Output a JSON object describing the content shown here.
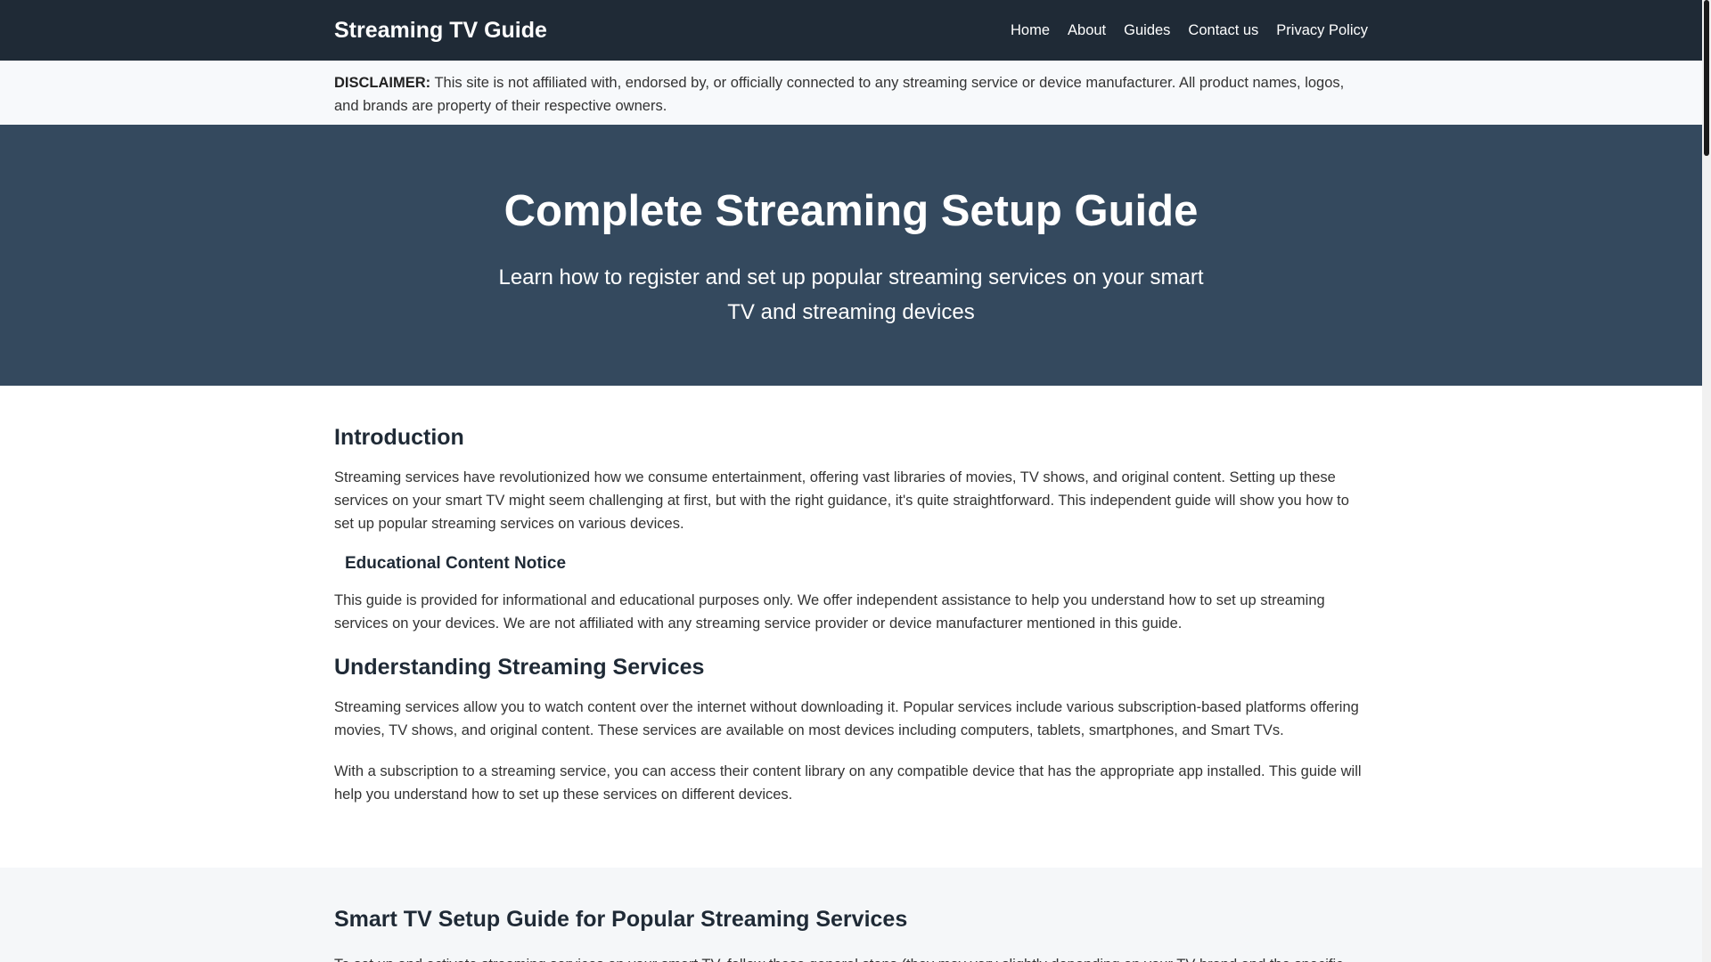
{
  "header": {
    "brand": "Streaming TV Guide",
    "nav": [
      "Home",
      "About",
      "Guides",
      "Contact us",
      "Privacy Policy"
    ]
  },
  "disclaimer": {
    "label": "DISCLAIMER:",
    "text": " This site is not affiliated with, endorsed by, or officially connected to any streaming service or device manufacturer. All product names, logos, and brands are property of their respective owners."
  },
  "hero": {
    "title": "Complete Streaming Setup Guide",
    "subtitle": "Learn how to register and set up popular streaming services on your smart TV and streaming devices"
  },
  "intro": {
    "heading": "Introduction",
    "paragraph": "Streaming services have revolutionized how we consume entertainment, offering vast libraries of movies, TV shows, and original content. Setting up these services on your smart TV might seem challenging at first, but with the right guidance, it's quite straightforward. This independent guide will show you how to set up popular streaming services on various devices.",
    "notice_heading": "Educational Content Notice",
    "notice_text": "This guide is provided for informational and educational purposes only. We offer independent assistance to help you understand how to set up streaming services on your devices. We are not affiliated with any streaming service provider or device manufacturer mentioned in this guide."
  },
  "understanding": {
    "heading": "Understanding Streaming Services",
    "p1": "Streaming services allow you to watch content over the internet without downloading it. Popular services include various subscription-based platforms offering movies, TV shows, and original content. These services are available on most devices including computers, tablets, smartphones, and Smart TVs.",
    "p2": "With a subscription to a streaming service, you can access their content library on any compatible device that has the appropriate app installed. This guide will help you understand how to set up these services on different devices."
  },
  "smart_tv": {
    "heading": "Smart TV Setup Guide for Popular Streaming Services",
    "text": "To set up and activate streaming services on your smart TV, follow these general steps (they may vary slightly depending on your TV brand and the specific"
  }
}
